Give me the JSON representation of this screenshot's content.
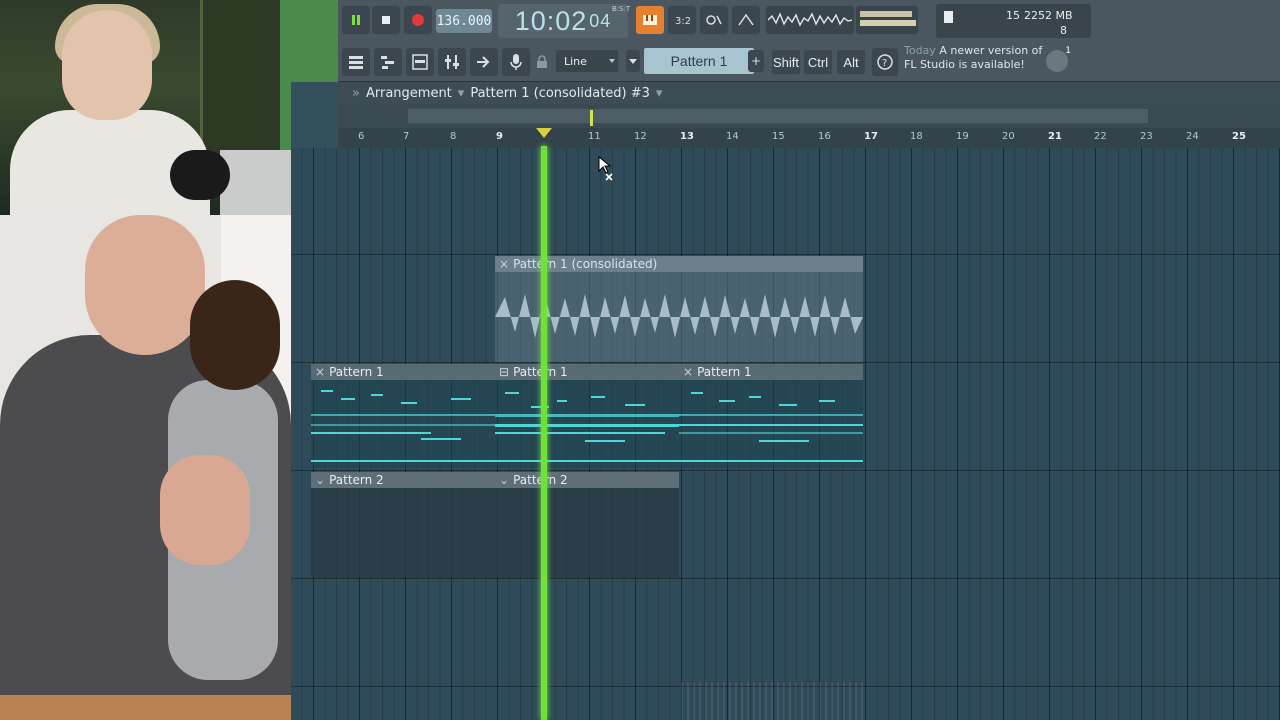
{
  "colors": {
    "playhead": "#6fe23a",
    "pattern_notes": "#4fd6d8",
    "audio_wave": "#b8ccd6",
    "grid_bg": "#2f4b59",
    "toolbar_bg": "#4a5660"
  },
  "transport": {
    "tempo": "136.000",
    "clock_main": "10:02",
    "clock_sub": "04",
    "clock_label": "B:S:T",
    "play_icon": "pause-icon",
    "stop_icon": "stop-icon",
    "record_icon": "record-icon"
  },
  "toolbar": {
    "snap_mode": "Line",
    "pattern_selector": "Pattern 1",
    "pattern_add": "+",
    "modifiers": [
      "Shift",
      "Ctrl",
      "Alt"
    ],
    "cpu_num1": "15",
    "memory": "2252 MB",
    "polyphony": "8",
    "hint_today": "Today",
    "hint_text_1": "A newer version of",
    "hint_text_2": "FL Studio is available!",
    "hint_badge": "1"
  },
  "playlist": {
    "title_arrow": "»",
    "title_section": "Arrangement",
    "title_pattern": "Pattern 1 (consolidated) #3",
    "ruler": [
      "6",
      "7",
      "8",
      "9",
      "",
      "11",
      "12",
      "13",
      "14",
      "15",
      "16",
      "17",
      "18",
      "19",
      "20",
      "21",
      "22",
      "23",
      "24",
      "25"
    ],
    "clips": {
      "audio": "Pattern 1 (consolidated)",
      "p1_a": "Pattern 1",
      "p1_b": "Pattern 1",
      "p1_c": "Pattern 1",
      "p2_a": "Pattern 2",
      "p2_b": "Pattern 2"
    }
  }
}
